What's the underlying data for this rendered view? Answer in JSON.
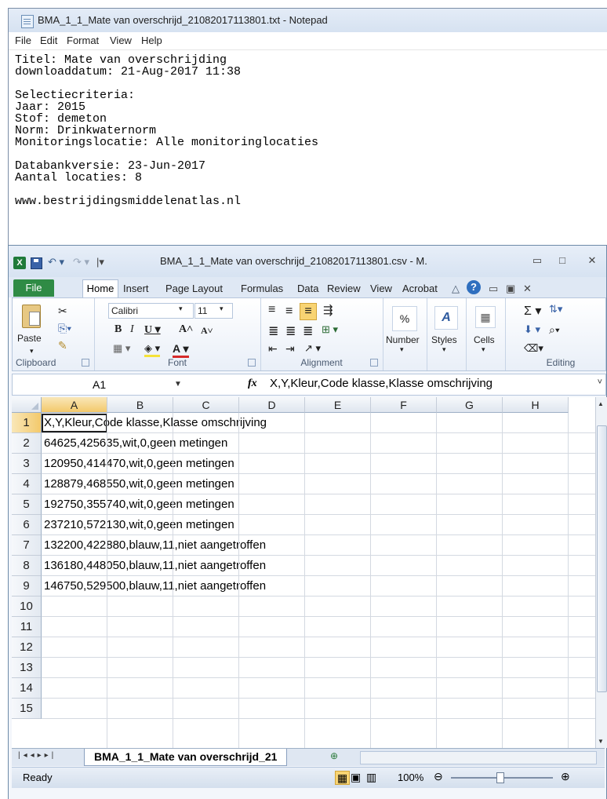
{
  "notepad": {
    "title": "BMA_1_1_Mate van overschrijd_21082017113801.txt - Notepad",
    "menu": [
      "File",
      "Edit",
      "Format",
      "View",
      "Help"
    ],
    "lines": [
      "Titel: Mate van overschrijding",
      "downloaddatum: 21-Aug-2017 11:38",
      "",
      "Selectiecriteria:",
      "Jaar: 2015",
      "Stof: demeton",
      "Norm: Drinkwaternorm",
      "Monitoringslocatie: Alle monitoringlocaties",
      "",
      "Databankversie: 23-Jun-2017",
      "Aantal locaties: 8",
      "",
      "www.bestrijdingsmiddelenatlas.nl"
    ]
  },
  "excel": {
    "title": "BMA_1_1_Mate van overschrijd_21082017113801.csv - M.",
    "tabs": [
      "File",
      "Home",
      "Insert",
      "Page Layout",
      "Formulas",
      "Data",
      "Review",
      "View",
      "Acrobat"
    ],
    "ribbon": {
      "clipboard": {
        "label": "Clipboard",
        "paste": "Paste"
      },
      "font": {
        "label": "Font",
        "name": "Calibri",
        "size": "11"
      },
      "alignment": {
        "label": "Alignment"
      },
      "number": {
        "label": "Number"
      },
      "styles": {
        "label": "Styles"
      },
      "cells": {
        "label": "Cells"
      },
      "editing": {
        "label": "Editing"
      }
    },
    "name_box": "A1",
    "formula": "X,Y,Kleur,Code klasse,Klasse omschrijving",
    "columns": [
      "A",
      "B",
      "C",
      "D",
      "E",
      "F",
      "G",
      "H"
    ],
    "rows": [
      {
        "n": "1",
        "a": "X,Y,Kleur,Code klasse,Klasse omschrijving"
      },
      {
        "n": "2",
        "a": "64625,425635,wit,0,geen metingen"
      },
      {
        "n": "3",
        "a": "120950,414470,wit,0,geen metingen"
      },
      {
        "n": "4",
        "a": "128879,468550,wit,0,geen metingen"
      },
      {
        "n": "5",
        "a": "192750,355740,wit,0,geen metingen"
      },
      {
        "n": "6",
        "a": "237210,572130,wit,0,geen metingen"
      },
      {
        "n": "7",
        "a": "132200,422880,blauw,11,niet aangetroffen"
      },
      {
        "n": "8",
        "a": "136180,448050,blauw,11,niet aangetroffen"
      },
      {
        "n": "9",
        "a": "146750,529500,blauw,11,niet aangetroffen"
      },
      {
        "n": "10",
        "a": ""
      },
      {
        "n": "11",
        "a": ""
      },
      {
        "n": "12",
        "a": ""
      },
      {
        "n": "13",
        "a": ""
      },
      {
        "n": "14",
        "a": ""
      },
      {
        "n": "15",
        "a": ""
      }
    ],
    "sheet_tab": "BMA_1_1_Mate van overschrijd_21",
    "status": "Ready",
    "zoom": "100%"
  }
}
